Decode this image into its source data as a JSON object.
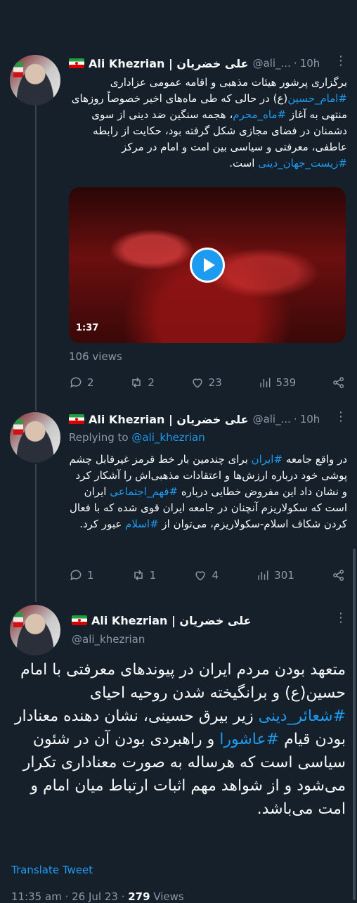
{
  "tweets": [
    {
      "name": "Ali Khezrian | علی خضریان",
      "handle": "@ali_...",
      "time": "10h",
      "more": "⋮",
      "text_parts": [
        "برگزاری پرشور هیئات مذهبی و اقامه عمومی عزاداری",
        "#امام_حسین",
        "(ع) در حالی که طی ماه‌های اخیر خصوصاً روزهای منتهی به آغاز",
        "#ماه_محرم",
        "، هجمه سنگین ضد دینی از سوی دشمنان در فضای مجازی شکل گرفته بود، حکایت از رابطه عاطفی، معرفتی و سیاسی بین امت و امام در مرکز",
        "#زیست_جهان_دینی",
        "است."
      ],
      "video_duration": "1:37",
      "views": "106 views",
      "replies": "2",
      "retweets": "2",
      "likes": "23",
      "view_count": "539"
    },
    {
      "name": "Ali Khezrian | علی خضریان",
      "handle": "@ali_...",
      "time": "10h",
      "more": "⋮",
      "replying_label": "Replying to",
      "replying_handle": "@ali_khezrian",
      "text_parts": [
        "در واقع جامعه",
        "#ایران",
        "برای چندمین بار خط قرمز غیرقابل چشم پوشی خود درباره ارزش‌ها و اعتقادات مذهبی‌اش را آشکار کرد و نشان داد این مفروض خطایی درباره",
        "#فهم_اجتماعی",
        "ایران است که سکولاریزم آنچنان در جامعه ایران قوی شده که با فعال کردن شکاف اسلام-سکولاریزم، می‌توان از",
        "#اسلام",
        "عبور کرد."
      ],
      "replies": "1",
      "retweets": "1",
      "likes": "4",
      "view_count": "301"
    }
  ],
  "main_tweet": {
    "name": "Ali Khezrian | علی خضریان",
    "handle": "@ali_khezrian",
    "more": "⋮",
    "text_parts": [
      "متعهد بودن مردم ایران در پیوندهای معرفتی با امام حسین(ع) و برانگیخته شدن روحیه احیای",
      "#شعائر_دینی",
      "زیر بیرق حسینی، نشان دهنده معنادار بودن قیام",
      "#عاشورا",
      "و راهبردی بودن آن در شئون سیاسی است که هرساله به صورت معناداری تکرار می‌شود و از شواهد مهم اثبات ارتباط میان امام و امت می‌باشد."
    ],
    "translate_label": "Translate Tweet",
    "timestamp": "11:35 am · 26 Jul 23 ·",
    "views_count": "279",
    "views_label": "Views"
  },
  "colors": {
    "background": "#15202b",
    "link": "#1d9bf0",
    "muted": "#8b98a5"
  }
}
